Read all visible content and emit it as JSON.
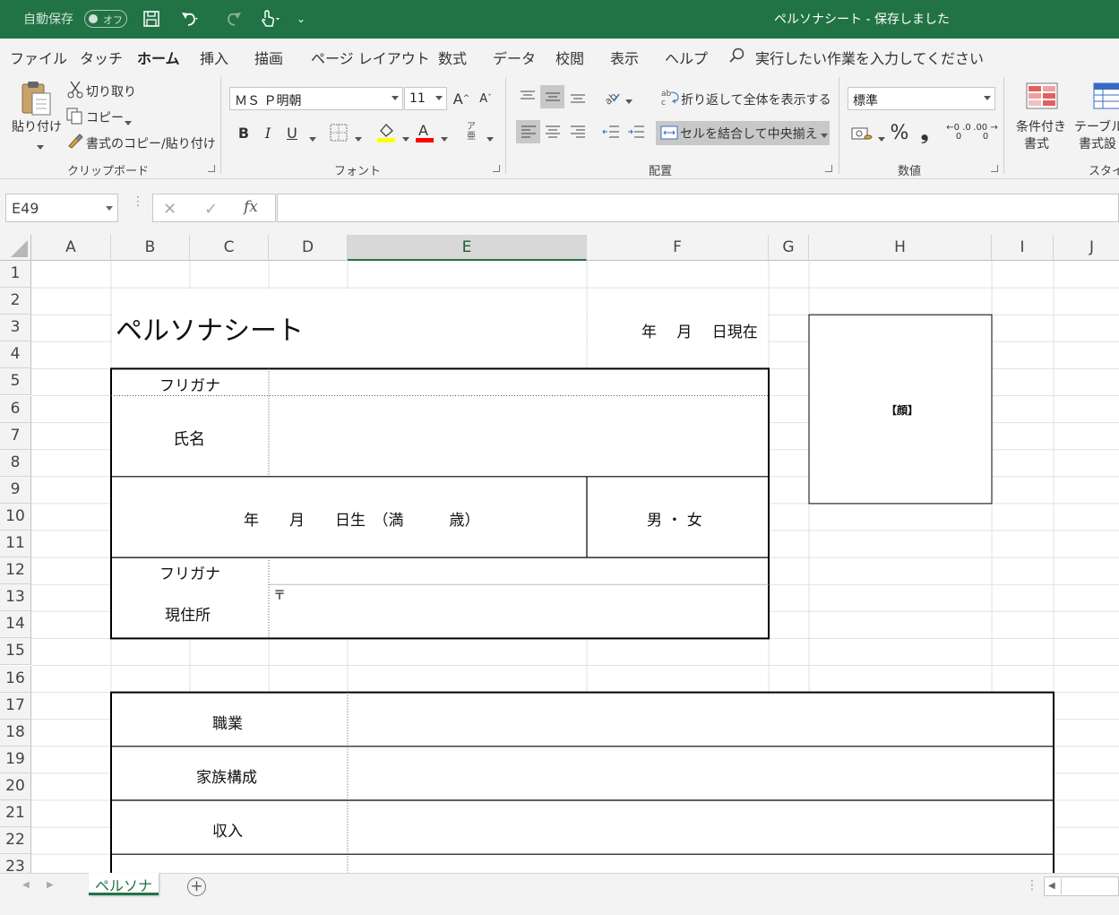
{
  "titlebar": {
    "autosave_label": "自動保存",
    "autosave_state": "オフ",
    "doc_title": "ペルソナシート  -  保存しました",
    "bg_color": "#217346"
  },
  "menu": {
    "tabs": [
      "ファイル",
      "タッチ",
      "ホーム",
      "挿入",
      "描画",
      "ページ レイアウト",
      "数式",
      "データ",
      "校閲",
      "表示",
      "ヘルプ"
    ],
    "active_tab": "ホーム",
    "search_placeholder": "実行したい作業を入力してください"
  },
  "ribbon": {
    "clipboard": {
      "paste": "貼り付け",
      "cut": "切り取り",
      "copy": "コピー",
      "format_painter": "書式のコピー/貼り付け",
      "group": "クリップボード"
    },
    "font": {
      "name": "ＭＳ Ｐ明朝",
      "size": "11",
      "bold": "B",
      "italic": "I",
      "underline": "U",
      "group": "フォント",
      "furigana_top": "ア",
      "furigana_bottom": "亜"
    },
    "alignment": {
      "wrap": "折り返して全体を表示する",
      "merge": "セルを結合して中央揃え",
      "group": "配置"
    },
    "number": {
      "format": "標準",
      "percent": "%",
      "comma": "❟",
      "inc_decimal": "←0 .00",
      "dec_decimal": ".00 →0",
      "group": "数値"
    },
    "styles": {
      "cond_format_1": "条件付き",
      "cond_format_2": "書式",
      "table_1": "テーブルと",
      "table_2": "書式設",
      "group": "スタイル"
    }
  },
  "formula_bar": {
    "name_box": "E49",
    "fx": "fx",
    "formula": ""
  },
  "sheet": {
    "columns": [
      "A",
      "B",
      "C",
      "D",
      "E",
      "F",
      "G",
      "H",
      "I",
      "J"
    ],
    "rows": [
      "1",
      "2",
      "3",
      "4",
      "5",
      "6",
      "7",
      "8",
      "9",
      "10",
      "11",
      "12",
      "13",
      "14",
      "15",
      "16",
      "17",
      "18",
      "19",
      "20",
      "21",
      "22",
      "23"
    ],
    "selected_column": "E",
    "cells": {
      "title": "ペルソナシート",
      "date_now": "年　 月　 日現在",
      "photo": "【顔】",
      "furigana1": "フリガナ",
      "name_label": "氏名",
      "birth": "年　　月　　日生　（満　　　歳）",
      "gender": "男 ・ 女",
      "furigana2": "フリガナ",
      "postal": "〒",
      "address_label": "現住所",
      "occupation": "職業",
      "family": "家族構成",
      "income": "収入"
    }
  },
  "sheet_tabs": {
    "active": "ペルソナ",
    "add": "+"
  }
}
